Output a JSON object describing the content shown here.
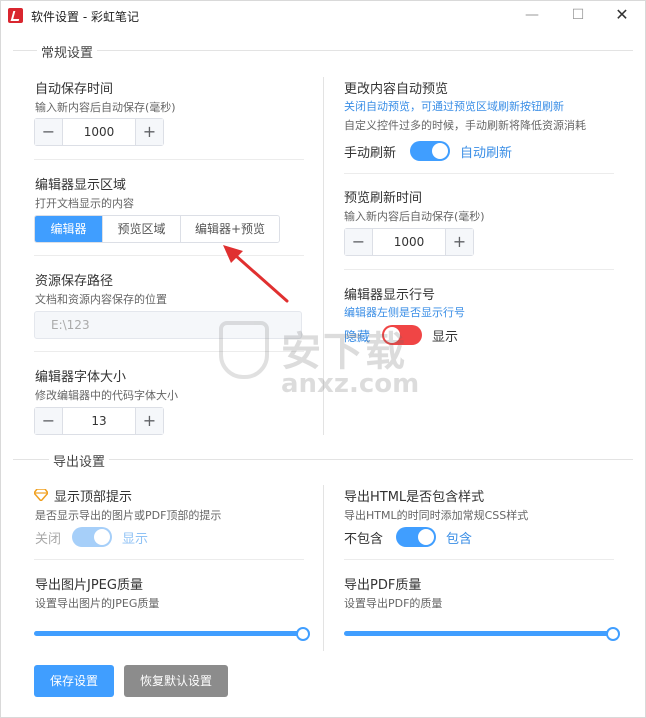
{
  "window": {
    "title": "软件设置 - 彩虹笔记",
    "min_glyph": "—",
    "max_glyph": "☐",
    "close_glyph": "✕"
  },
  "general": {
    "section_title": "常规设置",
    "autosave": {
      "label": "自动保存时间",
      "desc": "输入新内容后自动保存(毫秒)",
      "value": "1000",
      "minus": "−",
      "plus": "+"
    },
    "editor_area": {
      "label": "编辑器显示区域",
      "desc": "打开文档显示的内容",
      "options": [
        "编辑器",
        "预览区域",
        "编辑器+预览"
      ],
      "selected": "编辑器"
    },
    "resource_path": {
      "label": "资源保存路径",
      "desc": "文档和资源内容保存的位置",
      "value": "E:\\123"
    },
    "font_size": {
      "label": "编辑器字体大小",
      "desc": "修改编辑器中的代码字体大小",
      "value": "13",
      "minus": "−",
      "plus": "+"
    },
    "auto_preview": {
      "label": "更改内容自动预览",
      "desc_blue": "关闭自动预览，可通过预览区域刷新按钮刷新",
      "desc": "自定义控件过多的时候，手动刷新将降低资源消耗",
      "off_label": "手动刷新",
      "on_label": "自动刷新",
      "enabled": true
    },
    "preview_refresh": {
      "label": "预览刷新时间",
      "desc": "输入新内容后自动保存(毫秒)",
      "value": "1000",
      "minus": "−",
      "plus": "+"
    },
    "line_numbers": {
      "label": "编辑器显示行号",
      "desc_blue": "编辑器左侧是否显示行号",
      "off_label": "隐藏",
      "on_label": "显示",
      "enabled": false
    }
  },
  "export": {
    "section_title": "导出设置",
    "top_hint": {
      "label": "显示顶部提示",
      "desc": "是否显示导出的图片或PDF顶部的提示",
      "off_label": "关闭",
      "on_label": "显示",
      "enabled": true,
      "disabled_state": true
    },
    "html_style": {
      "label": "导出HTML是否包含样式",
      "desc": "导出HTML的时同时添加常规CSS样式",
      "off_label": "不包含",
      "on_label": "包含",
      "enabled": true
    },
    "jpeg_quality": {
      "label": "导出图片JPEG质量",
      "desc": "设置导出图片的JPEG质量",
      "value_fraction": 1.0
    },
    "pdf_quality": {
      "label": "导出PDF质量",
      "desc": "设置导出PDF的质量",
      "value_fraction": 1.0
    }
  },
  "actions": {
    "save_label": "保存设置",
    "reset_label": "恢复默认设置"
  },
  "watermark": {
    "brand_cn": "安下载",
    "brand_en": "anxz.com"
  },
  "colors": {
    "accent": "#409eff",
    "danger": "#f04545",
    "arrow": "#e03030",
    "gem": "#f0a020"
  }
}
